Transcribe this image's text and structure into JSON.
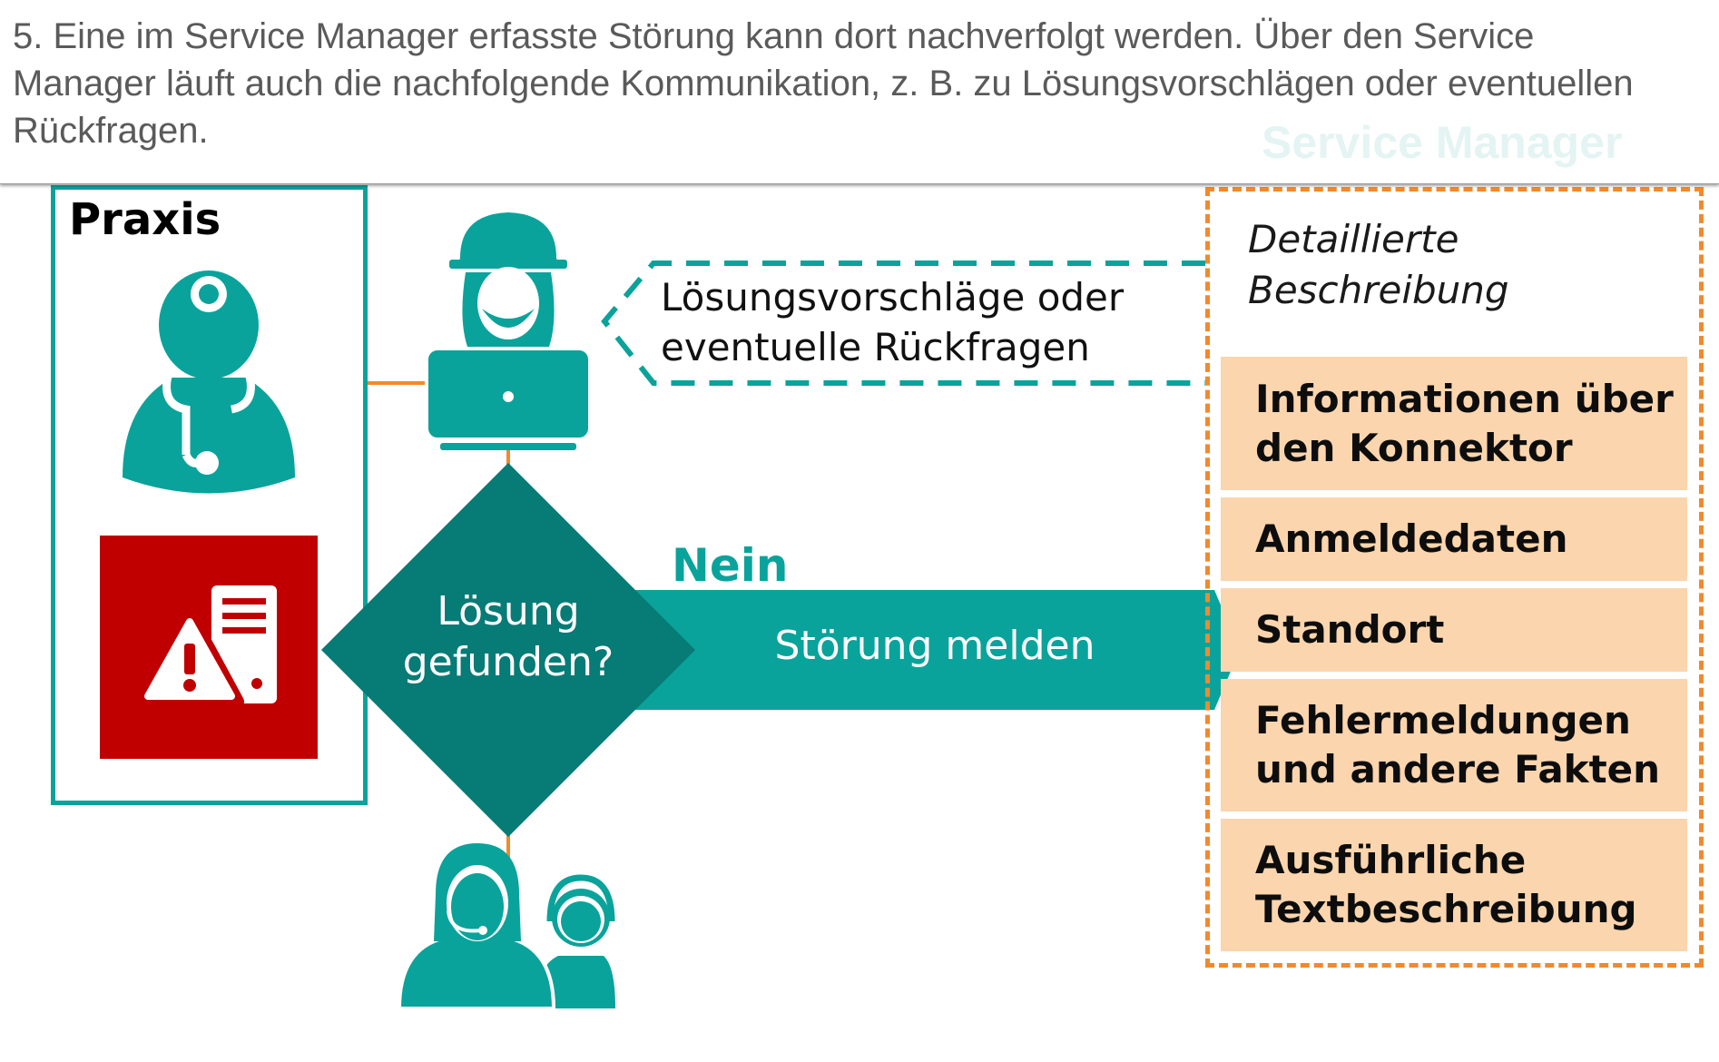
{
  "caption": {
    "text": "5. Eine im Service Manager erfasste Störung kann dort nachverfolgt werden. Über den Service Manager läuft auch die nachfolgende Kommunikation, z. B. zu Lösungsvorschlägen oder eventuellen Rückfragen.",
    "overlay_title": "Service Manager"
  },
  "praxis": {
    "label": "Praxis",
    "icons": [
      "doctor-icon",
      "server-warning-icon"
    ]
  },
  "technician": {
    "icon": "technician-laptop-icon"
  },
  "support": {
    "icon": "support-agents-icon"
  },
  "callout": {
    "line1": "Lösungsvorschläge oder",
    "line2": "eventuelle Rückfragen"
  },
  "decision": {
    "line1": "Lösung",
    "line2": "gefunden?"
  },
  "flow": {
    "no_label": "Nein",
    "arrow_label": "Störung melden"
  },
  "service_manager": {
    "subtitle_line1": "Detaillierte",
    "subtitle_line2": "Beschreibung",
    "items": [
      {
        "line1": "Informationen über",
        "line2": "den Konnektor"
      },
      {
        "line1": "Anmeldedaten",
        "line2": ""
      },
      {
        "line1": "Standort",
        "line2": ""
      },
      {
        "line1": "Fehlermeldungen",
        "line2": "und andere Fakten"
      },
      {
        "line1": "Ausführliche",
        "line2": "Textbeschreibung"
      }
    ]
  },
  "colors": {
    "teal": "#0aa39b",
    "dark_teal": "#077b76",
    "orange": "#f08a2e",
    "peach": "#fbd5ad",
    "red": "#c00000"
  }
}
